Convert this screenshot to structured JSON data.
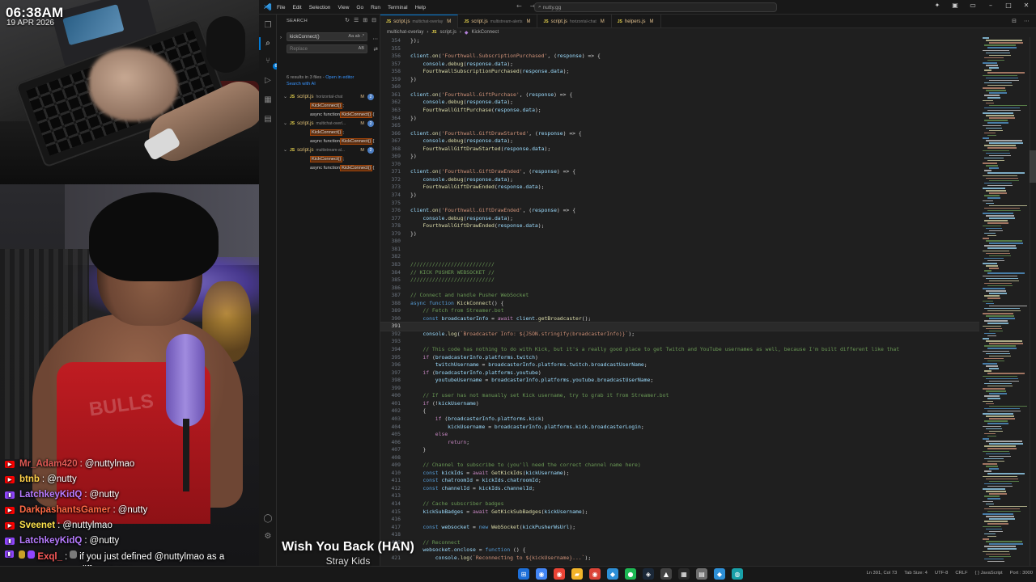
{
  "overlay": {
    "clock_time": "06:38AM",
    "clock_date": "19 APR 2026",
    "now_playing": {
      "title": "Wish You Back (HAN)",
      "artist": "Stray Kids"
    },
    "chat": [
      {
        "platform": "youtube",
        "user": "Mr_Adam420",
        "sep": ":",
        "message": "@nuttylmao",
        "color": "#e05a55"
      },
      {
        "platform": "youtube",
        "user": "btnb",
        "sep": ":",
        "message": "@nutty",
        "color": "#ffd24a"
      },
      {
        "platform": "twitch",
        "user": "LatchkeyKidQ",
        "sep": ":",
        "message": "@nutty",
        "color": "#b77bff"
      },
      {
        "platform": "youtube",
        "user": "DarkpashantsGamer",
        "sep": ":",
        "message": "@nutty",
        "color": "#ff6a45"
      },
      {
        "platform": "youtube",
        "user": "Sveenet",
        "sep": ":",
        "message": "@nuttylmao",
        "color": "#ffe44d"
      },
      {
        "platform": "twitch",
        "user": "LatchkeyKidQ",
        "sep": ":",
        "message": "@nutty",
        "color": "#b77bff"
      },
      {
        "platform": "twitch",
        "user": "Exql_",
        "sep": ":",
        "message": "if you just defined @nuttylmao as a different one",
        "color": "#ff5a5a"
      }
    ]
  },
  "vscode": {
    "menu": [
      "File",
      "Edit",
      "Selection",
      "View",
      "Go",
      "Run",
      "Terminal",
      "Help"
    ],
    "command_center": "nutty.gg",
    "nav_back": "←",
    "nav_forward": "→",
    "sidebar": {
      "title": "SEARCH",
      "query": "kickConnect()",
      "query_opts": "Aa ab .*",
      "replace_placeholder": "Replace",
      "replace_opts": "AB",
      "summary_results": "6 results in 3 files",
      "summary_open": "Open in editor",
      "summary_ai": "Search with AI",
      "files": [
        {
          "name": "script.js",
          "path": "horizontal-chat",
          "flag": "M",
          "count": "2",
          "matches": [
            {
              "pre": "",
              "hl": "KickConnect()",
              "post": ";"
            },
            {
              "pre": "async function ",
              "hl": "KickConnect()",
              "post": " {"
            }
          ]
        },
        {
          "name": "script.js",
          "path": "multichat-overl...",
          "flag": "M",
          "count": "2",
          "matches": [
            {
              "pre": "",
              "hl": "KickConnect()",
              "post": ";"
            },
            {
              "pre": "async function ",
              "hl": "KickConnect()",
              "post": " {"
            }
          ]
        },
        {
          "name": "script.js",
          "path": "multistream-al...",
          "flag": "M",
          "count": "2",
          "matches": [
            {
              "pre": "",
              "hl": "KickConnect()",
              "post": ";"
            },
            {
              "pre": "async function ",
              "hl": "KickConnect()",
              "post": " {"
            }
          ]
        }
      ]
    },
    "tabs": [
      {
        "name": "script.js",
        "path": "multichat-overlay",
        "flag": "M",
        "active": true
      },
      {
        "name": "script.js",
        "path": "multistream-alerts",
        "flag": "M",
        "active": false
      },
      {
        "name": "script.js",
        "path": "horizontal-chat",
        "flag": "M",
        "active": false
      },
      {
        "name": "helpers.js",
        "path": "",
        "flag": "M",
        "active": false
      }
    ],
    "breadcrumb": [
      "multichat-overlay",
      "JS",
      "script.js",
      "KickConnect"
    ],
    "status": [
      "Ln 391, Col 73",
      "Tab Size: 4",
      "UTF-8",
      "CRLF",
      "{ } JavaScript",
      "Port : 3000"
    ],
    "code_start_line": 354,
    "current_line": 391,
    "code": [
      "});",
      "",
      "client.on('Fourthwall.SubscriptionPurchased', (response) => {",
      "    console.debug(response.data);",
      "    FourthwallSubscriptionPurchased(response.data);",
      "})",
      "",
      "client.on('Fourthwall.GiftPurchase', (response) => {",
      "    console.debug(response.data);",
      "    FourthwallGiftPurchase(response.data);",
      "})",
      "",
      "client.on('Fourthwall.GiftDrawStarted', (response) => {",
      "    console.debug(response.data);",
      "    FourthwallGiftDrawStarted(response.data);",
      "})",
      "",
      "client.on('Fourthwall.GiftDrawEnded', (response) => {",
      "    console.debug(response.data);",
      "    FourthwallGiftDrawEnded(response.data);",
      "})",
      "",
      "client.on('Fourthwall.GiftDrawEnded', (response) => {",
      "    console.debug(response.data);",
      "    FourthwallGiftDrawEnded(response.data);",
      "})",
      "",
      "",
      "",
      "///////////////////////////",
      "// KICK PUSHER WEBSOCKET //",
      "///////////////////////////",
      "",
      "// Connect and handle Pusher WebSocket",
      "async function KickConnect() {",
      "    // Fetch from Streamer.bot",
      "    const broadcasterInfo = await client.getBroadcaster();",
      "",
      "    console.log(`Broadcaster Info: ${JSON.stringify(broadcasterInfo)}`);",
      "",
      "    // This code has nothing to do with Kick, but it's a really good place to get Twitch and YouTube usernames as well, because I'm built different like that",
      "    if (broadcasterInfo.platforms.twitch)",
      "        twitchUsername = broadcasterInfo.platforms.twitch.broadcastUserName;",
      "    if (broadcasterInfo.platforms.youtube)",
      "        youtubeUsername = broadcasterInfo.platforms.youtube.broadcastUserName;",
      "",
      "    // If user has not manually set Kick username, try to grab it from Streamer.bot",
      "    if (!kickUsername)",
      "    {",
      "        if (broadcasterInfo.platforms.kick)",
      "            kickUsername = broadcasterInfo.platforms.kick.broadcasterLogin;",
      "        else",
      "            return;",
      "    }",
      "",
      "    // Channel to subscribe to (you'll need the correct channel name here)",
      "    const kickIds = await GetKickIds(kickUsername);",
      "    const chatroomId = kickIds.chatroomId;",
      "    const channelId = kickIds.channelId;",
      "",
      "    // Cache subscriber badges",
      "    kickSubBadges = await GetKickSubBadges(kickUsername);",
      "",
      "    const websocket = new WebSocket(kickPusherWsUrl);",
      "",
      "    // Reconnect",
      "    websocket.onclose = function () {",
      "        console.log(`Reconnecting to ${kickUsername}...`);"
    ]
  },
  "colors": {
    "keyword": "#569cd6",
    "control": "#c586c0",
    "function": "#dcdcaa",
    "string": "#ce9178",
    "variable": "#9cdcfe",
    "comment": "#6a9955",
    "plain": "#d4d4d4",
    "accent": "#0078d4"
  },
  "taskbar_icons": [
    "windows-start-icon",
    "chrome-icon",
    "chrome-icon",
    "file-explorer-icon",
    "chrome-icon",
    "vscode-icon",
    "spotify-icon",
    "steam-icon",
    "app-icon",
    "streamdeck-icon",
    "notes-icon",
    "vscode-icon",
    "edge-icon"
  ]
}
